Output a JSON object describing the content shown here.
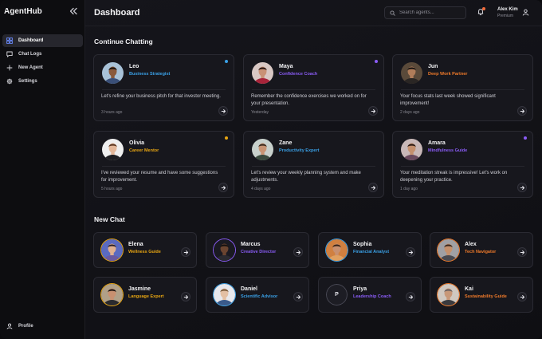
{
  "app": {
    "name": "AgentHub"
  },
  "sidebar": {
    "items": [
      {
        "label": "Dashboard",
        "icon": "grid-icon"
      },
      {
        "label": "Chat Logs",
        "icon": "chat-bubble-icon"
      },
      {
        "label": "New Agent",
        "icon": "plus-icon"
      },
      {
        "label": "Settings",
        "icon": "gear-icon"
      }
    ],
    "profile_label": "Profile"
  },
  "header": {
    "title": "Dashboard",
    "search_placeholder": "Search agents...",
    "user_name": "Alex Kim",
    "user_plan": "Premium"
  },
  "colors": {
    "blue": "#3aa0e6",
    "purple": "#8a5cf6",
    "orange": "#f07a2a",
    "amber": "#e7a512",
    "notification": "#f26b3a"
  },
  "continue_chatting": {
    "title": "Continue Chatting",
    "cards": [
      {
        "name": "Leo",
        "role": "Business Strategist",
        "role_color": "#3aa0e6",
        "dot_color": "#3aa0e6",
        "message": "Let's refine your business pitch for that investor meeting.",
        "time": "3 hours ago",
        "skin": "#8a5a3c",
        "hair": "#1c1410",
        "shirt": "#3a4f78",
        "bg": "#a8c2d8"
      },
      {
        "name": "Maya",
        "role": "Confidence Coach",
        "role_color": "#8a5cf6",
        "dot_color": "#8a5cf6",
        "message": "Remember the confidence exercises we worked on for your presentation.",
        "time": "Yesterday",
        "skin": "#c99276",
        "hair": "#2a1612",
        "shirt": "#a8243a",
        "bg": "#d9c8c4"
      },
      {
        "name": "Jun",
        "role": "Deep Work Partner",
        "role_color": "#f07a2a",
        "dot_color": "",
        "message": "Your focus stats last week showed significant improvement!",
        "time": "2 days ago",
        "skin": "#b07d5a",
        "hair": "#161210",
        "shirt": "#2a2624",
        "bg": "#5a4a3a"
      },
      {
        "name": "Olivia",
        "role": "Career Mentor",
        "role_color": "#e7a512",
        "dot_color": "#e7a512",
        "message": "I've reviewed your resume and have some suggestions for improvement.",
        "time": "5 hours ago",
        "skin": "#e4b89a",
        "hair": "#5a3620",
        "shirt": "#1e1e22",
        "bg": "#efefef"
      },
      {
        "name": "Zane",
        "role": "Productivity Expert",
        "role_color": "#3aa0e6",
        "dot_color": "",
        "message": "Let's review your weekly planning system and make adjustments.",
        "time": "4 days ago",
        "skin": "#c89474",
        "hair": "#3a2a1e",
        "shirt": "#3a4a3e",
        "bg": "#c8d0cc"
      },
      {
        "name": "Amara",
        "role": "Mindfulness Guide",
        "role_color": "#8a5cf6",
        "dot_color": "#8a5cf6",
        "message": "Your meditation streak is impressive! Let's work on deepening your practice.",
        "time": "1 day ago",
        "skin": "#c4906e",
        "hair": "#2a1a14",
        "shirt": "#6a4a5e",
        "bg": "#c8b8b8"
      }
    ]
  },
  "new_chat": {
    "title": "New Chat",
    "cards": [
      {
        "name": "Elena",
        "role": "Wellness Guide",
        "role_color": "#e7a512",
        "skin": "#e0b090",
        "hair": "#2a2028",
        "shirt": "#6a5aa0",
        "bg": "#5a6ac0",
        "letter": ""
      },
      {
        "name": "Marcus",
        "role": "Creative Director",
        "role_color": "#8a5cf6",
        "skin": "#6a4430",
        "hair": "#141010",
        "shirt": "#2a2a30",
        "bg": "#1a1a22",
        "letter": ""
      },
      {
        "name": "Sophia",
        "role": "Financial Analyst",
        "role_color": "#3aa0e6",
        "skin": "#c89070",
        "hair": "#3a2418",
        "shirt": "#e0a060",
        "bg": "#d08040",
        "letter": ""
      },
      {
        "name": "Alex",
        "role": "Tech Navigator",
        "role_color": "#f07a2a",
        "skin": "#c4906c",
        "hair": "#3a2a20",
        "shirt": "#4a4a50",
        "bg": "#a0a0a4",
        "letter": ""
      },
      {
        "name": "Jasmine",
        "role": "Language Expert",
        "role_color": "#e7a512",
        "skin": "#c89070",
        "hair": "#1c1410",
        "shirt": "#2a2a2e",
        "bg": "#b0a088",
        "letter": ""
      },
      {
        "name": "Daniel",
        "role": "Scientific Advisor",
        "role_color": "#3aa0e6",
        "skin": "#e4c0a4",
        "hair": "#7a5a3a",
        "shirt": "#3a5a8a",
        "bg": "#e8e8ec",
        "letter": ""
      },
      {
        "name": "Priya",
        "role": "Leadership Coach",
        "role_color": "#8a5cf6",
        "skin": "",
        "hair": "",
        "shirt": "",
        "bg": "",
        "letter": "P"
      },
      {
        "name": "Kai",
        "role": "Sustainability Guide",
        "role_color": "#f07a2a",
        "skin": "#c89878",
        "hair": "#6a6060",
        "shirt": "#3a3a3e",
        "bg": "#d0c8c0",
        "letter": ""
      }
    ]
  }
}
